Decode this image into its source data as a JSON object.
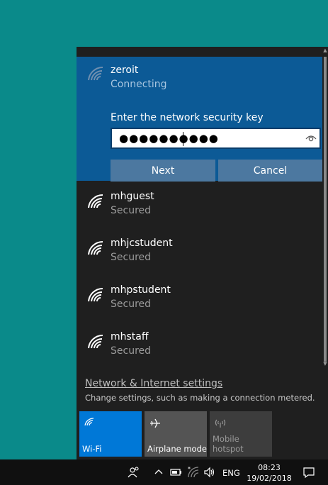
{
  "connecting": {
    "ssid": "zeroit",
    "status": "Connecting",
    "key_label": "Enter the network security key",
    "key_masked": "●●●●●●●●●●",
    "next_label": "Next",
    "cancel_label": "Cancel"
  },
  "networks": [
    {
      "ssid": "mhguest",
      "status": "Secured"
    },
    {
      "ssid": "mhjcstudent",
      "status": "Secured"
    },
    {
      "ssid": "mhpstudent",
      "status": "Secured"
    },
    {
      "ssid": "mhstaff",
      "status": "Secured"
    }
  ],
  "settings": {
    "link": "Network & Internet settings",
    "description": "Change settings, such as making a connection metered."
  },
  "quick_actions": [
    {
      "label": "Wi-Fi",
      "state": "on",
      "icon": "wifi-icon"
    },
    {
      "label": "Airplane mode",
      "state": "off",
      "icon": "airplane-icon"
    },
    {
      "label": "Mobile hotspot",
      "state": "disabled",
      "icon": "hotspot-icon"
    }
  ],
  "taskbar": {
    "language": "ENG",
    "time": "08:23",
    "date": "19/02/2018"
  },
  "colors": {
    "accent": "#0078d7",
    "connect_panel": "#0c5a96",
    "flyout_bg": "#1f1f1f",
    "desktop": "#0a8a8a"
  }
}
